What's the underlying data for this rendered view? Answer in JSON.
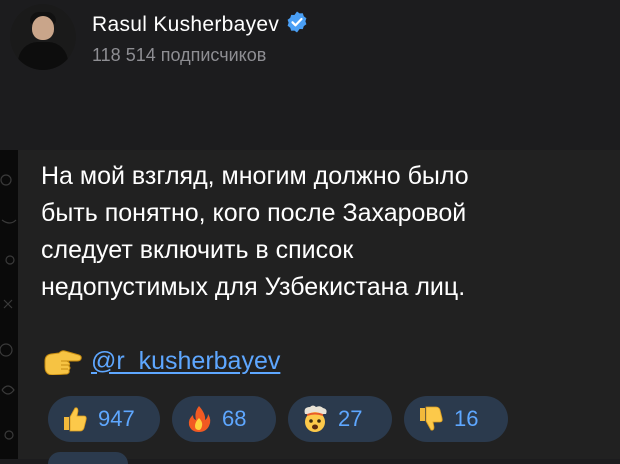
{
  "channel": {
    "name": "Rasul Kusherbayev",
    "verified_icon": "verified-badge-icon",
    "subscribers": "118 514 подписчиков"
  },
  "message": {
    "lines": [
      "На мой взгляд, многим должно было",
      "быть понятно, кого после Захаровой",
      "следует включить в список",
      "недопустимых для Узбекистана лиц."
    ],
    "pointer_icon": "backhand-index-pointing-right-icon",
    "link": "@r_kusherbayev"
  },
  "reactions": [
    {
      "icon": "thumbs-up-icon",
      "count": "947"
    },
    {
      "icon": "fire-icon",
      "count": "68"
    },
    {
      "icon": "exploding-head-icon",
      "count": "27"
    },
    {
      "icon": "thumbs-down-icon",
      "count": "16"
    }
  ],
  "colors": {
    "background": "#1c1c1e",
    "bubble": "#212121",
    "accent": "#5ea7ff",
    "reaction_bg": "#2b3a4d",
    "muted": "#8e8e93"
  }
}
